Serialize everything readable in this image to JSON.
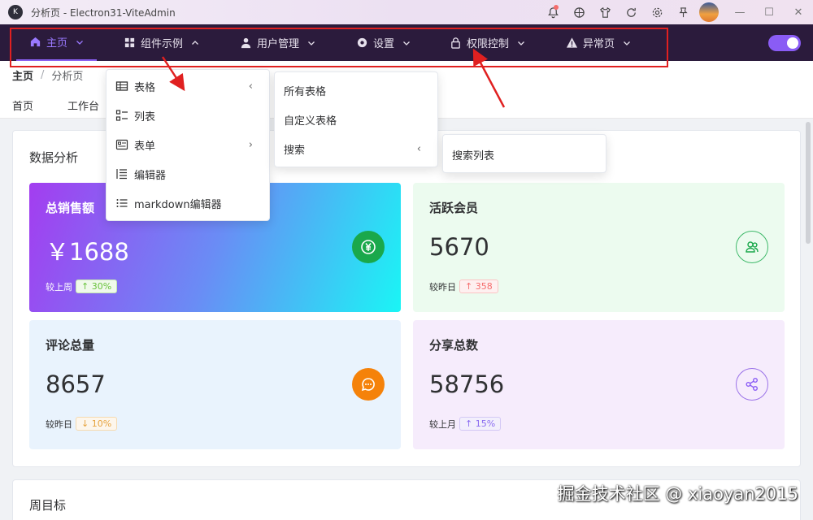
{
  "window": {
    "title": "分析页 - Electron31-ViteAdmin",
    "logo_text": "K"
  },
  "menu": [
    {
      "label": "主页",
      "icon": "home-icon",
      "active": true
    },
    {
      "label": "组件示例",
      "icon": "grid-icon"
    },
    {
      "label": "用户管理",
      "icon": "user-icon"
    },
    {
      "label": "设置",
      "icon": "gear-icon"
    },
    {
      "label": "权限控制",
      "icon": "lock-icon"
    },
    {
      "label": "异常页",
      "icon": "warning-icon"
    }
  ],
  "breadcrumb": {
    "root": "主页",
    "sep": "/",
    "current": "分析页"
  },
  "tags": [
    "首页",
    "工作台"
  ],
  "panel": {
    "title": "数据分析",
    "next_title": "周目标"
  },
  "stats": [
    {
      "label": "总销售额",
      "value": "￥1688",
      "compare_label": "较上周",
      "delta": "30%",
      "direction": "up",
      "icon": "yuan-icon"
    },
    {
      "label": "活跃会员",
      "value": "5670",
      "compare_label": "较昨日",
      "delta": "358",
      "direction": "up",
      "icon": "users-icon"
    },
    {
      "label": "评论总量",
      "value": "8657",
      "compare_label": "较昨日",
      "delta": "10%",
      "direction": "down",
      "icon": "chat-icon"
    },
    {
      "label": "分享总数",
      "value": "58756",
      "compare_label": "较上月",
      "delta": "15%",
      "direction": "up",
      "icon": "share-icon"
    }
  ],
  "dropdown_components": [
    {
      "label": "表格",
      "icon": "table-icon",
      "has_sub": true,
      "arrow": "‹"
    },
    {
      "label": "列表",
      "icon": "list-icon",
      "has_sub": false
    },
    {
      "label": "表单",
      "icon": "form-icon",
      "has_sub": true,
      "arrow": "›"
    },
    {
      "label": "编辑器",
      "icon": "editor-icon",
      "has_sub": false
    },
    {
      "label": "markdown编辑器",
      "icon": "markdown-icon",
      "has_sub": false
    }
  ],
  "dropdown_tables": [
    {
      "label": "所有表格",
      "has_sub": false
    },
    {
      "label": "自定义表格",
      "has_sub": false
    },
    {
      "label": "搜索",
      "has_sub": true,
      "arrow": "‹"
    }
  ],
  "dropdown_search": [
    {
      "label": "搜索列表"
    }
  ],
  "watermark": "掘金技术社区 @ xiaoyan2015",
  "colors": {
    "menubar": "#2b1b3c",
    "accent": "#8a5cf5",
    "annotation": "#e02020"
  }
}
